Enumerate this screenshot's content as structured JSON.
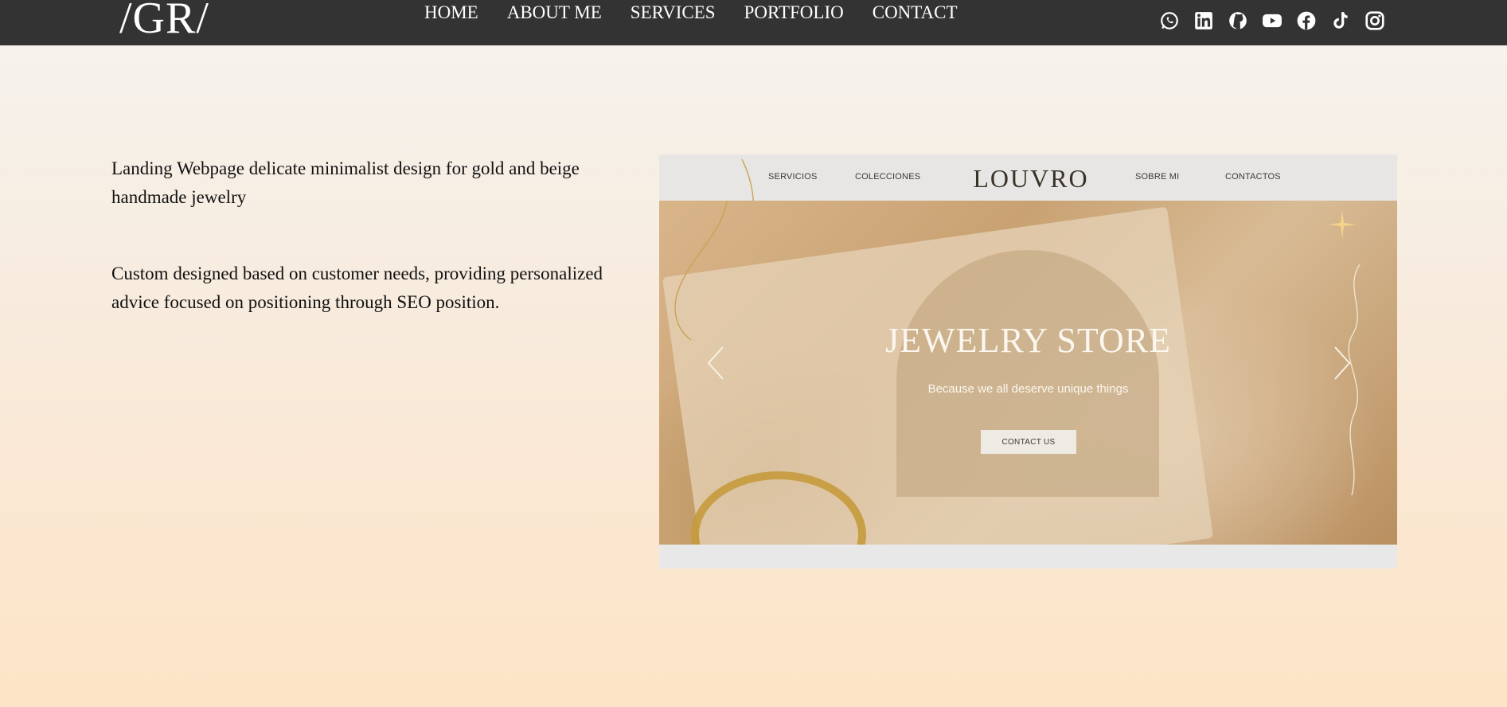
{
  "header": {
    "logo": "/GR/",
    "nav": [
      {
        "label": "HOME"
      },
      {
        "label": "ABOUT ME"
      },
      {
        "label": "SERVICES"
      },
      {
        "label": "PORTFOLIO"
      },
      {
        "label": "CONTACT"
      }
    ],
    "social_icons": [
      "whatsapp-icon",
      "linkedin-icon",
      "github-icon",
      "youtube-icon",
      "facebook-icon",
      "tiktok-icon",
      "instagram-icon"
    ]
  },
  "project": {
    "description_1": "Landing Webpage delicate minimalist design for gold and beige handmade jewelry",
    "description_2": "Custom designed based on customer needs, providing personalized advice focused on positioning through SEO position."
  },
  "preview": {
    "nav_left": [
      "SERVICIOS",
      "COLECCIONES"
    ],
    "brand": "LOUVRO",
    "nav_right": [
      "SOBRE MI",
      "CONTACTOS"
    ],
    "hero_title": "JEWELRY STORE",
    "hero_subtitle": "Because we all deserve unique things",
    "hero_button": "CONTACT US"
  },
  "colors": {
    "topbar": "#333333",
    "accent_gold": "#c59a3c",
    "hero_beige": "#d9b58a"
  }
}
